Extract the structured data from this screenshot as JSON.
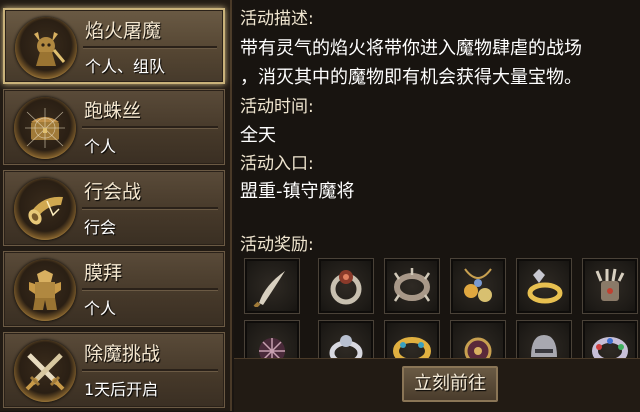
{
  "sidebar": {
    "items": [
      {
        "name": "焰火屠魔",
        "sub": "个人、组队",
        "icon": "demon-warrior-icon"
      },
      {
        "name": "跑蛛丝",
        "sub": "个人",
        "icon": "chest-web-icon"
      },
      {
        "name": "行会战",
        "sub": "行会",
        "icon": "war-horn-icon"
      },
      {
        "name": "膜拜",
        "sub": "个人",
        "icon": "armored-statue-icon"
      },
      {
        "name": "除魔挑战",
        "sub": "1天后开启",
        "icon": "crossed-swords-icon"
      }
    ],
    "selected": 0
  },
  "detail": {
    "desc_heading": "活动描述:",
    "desc_line1": "带有灵气的焰火将带你进入魔物肆虐的战场",
    "desc_line2": "，消灭其中的魔物即有机会获得大量宝物。",
    "time_heading": "活动时间:",
    "time_value": "全天",
    "entry_heading": "活动入口:",
    "entry_value": "盟重-镇守魔将",
    "reward_heading": "活动奖励:",
    "rewards": [
      "curved-blade-icon",
      "gem-ring-icon",
      "spiked-bracelet-icon",
      "jewel-amulet-icon",
      "gold-ring-icon",
      "spiked-gauntlet-icon",
      "cage-orb-icon",
      "silver-ring-icon",
      "gold-bracelet-icon",
      "dark-amulet-icon",
      "steel-helmet-icon",
      "jeweled-bangle-icon"
    ]
  },
  "footer": {
    "go_label": "立刻前往"
  },
  "colors": {
    "accent_gold": "#c9b27a",
    "panel_brown": "#453829",
    "background": "#181410"
  }
}
